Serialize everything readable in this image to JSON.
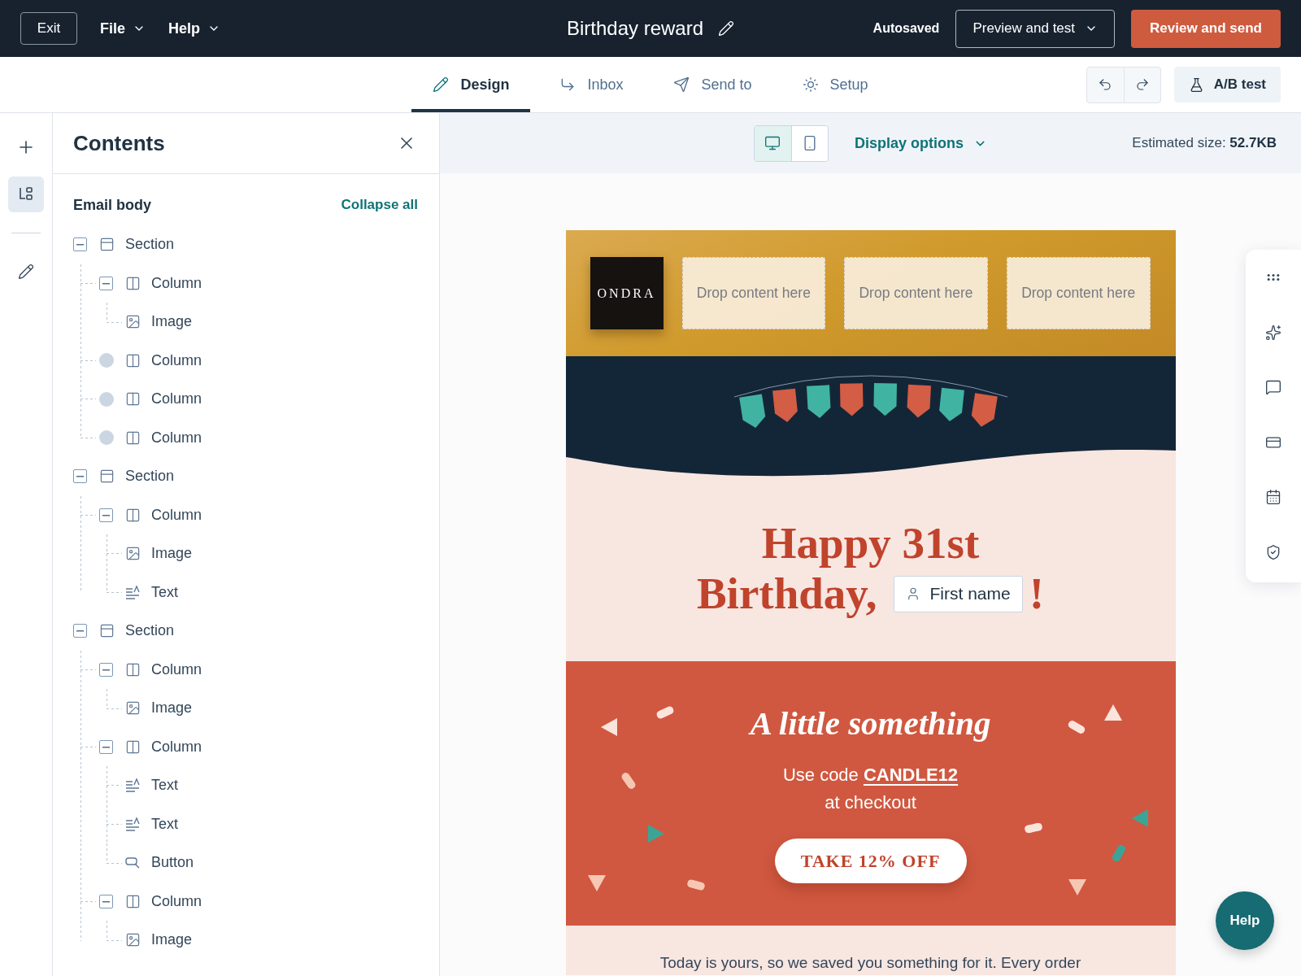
{
  "top_bar": {
    "exit_button": "Exit",
    "menus": [
      "File",
      "Help"
    ],
    "title": "Birthday reward",
    "save_status": "Autosaved",
    "preview_button": "Preview and test",
    "send_button": "Review and send"
  },
  "tabs": [
    {
      "label": "Design",
      "selected": true
    },
    {
      "label": "Inbox",
      "selected": false
    },
    {
      "label": "Send to",
      "selected": false
    },
    {
      "label": "Setup",
      "selected": false
    }
  ],
  "ab_test_button": "A/B test",
  "left_rail": [
    {
      "selected": false
    },
    {
      "selected": true
    },
    {
      "selected": false
    }
  ],
  "contents_panel": {
    "title": "Contents",
    "heading": "Email body",
    "collapse_all": "Collapse all",
    "tree": [
      {
        "kind": "section",
        "label": "Section",
        "expanded": true,
        "children": [
          {
            "kind": "column",
            "label": "Column",
            "expanded": true,
            "children": [
              {
                "kind": "image",
                "label": "Image"
              }
            ]
          },
          {
            "kind": "column",
            "label": "Column"
          },
          {
            "kind": "column",
            "label": "Column"
          },
          {
            "kind": "column",
            "label": "Column"
          }
        ]
      },
      {
        "kind": "section",
        "label": "Section",
        "expanded": true,
        "children": [
          {
            "kind": "column",
            "label": "Column",
            "expanded": true,
            "children": [
              {
                "kind": "image",
                "label": "Image"
              },
              {
                "kind": "text",
                "label": "Text"
              }
            ]
          }
        ]
      },
      {
        "kind": "section",
        "label": "Section",
        "expanded": true,
        "children": [
          {
            "kind": "column",
            "label": "Column",
            "expanded": true,
            "children": [
              {
                "kind": "image",
                "label": "Image"
              }
            ]
          },
          {
            "kind": "column",
            "label": "Column",
            "expanded": true,
            "children": [
              {
                "kind": "text",
                "label": "Text"
              },
              {
                "kind": "text",
                "label": "Text"
              },
              {
                "kind": "button",
                "label": "Button"
              }
            ]
          },
          {
            "kind": "column",
            "label": "Column",
            "expanded": true,
            "children": [
              {
                "kind": "image",
                "label": "Image"
              }
            ]
          }
        ]
      }
    ]
  },
  "canvas_toolbar": {
    "devices": [
      {
        "selected": true
      },
      {
        "selected": false
      }
    ],
    "display_options": "Display options",
    "estimated_size": "Estimated size: **52.7KB**"
  },
  "email": {
    "logo": "ONDRA",
    "drop_zones": [
      "Drop content here",
      "Drop content here",
      "Drop content here"
    ],
    "greeting": {
      "line_1": "Happy 31st",
      "line_2": "Birthday,",
      "token": "First name",
      "end": "!"
    },
    "promo": {
      "title": "A little something",
      "text": "Use code **CANDLE12** at checkout",
      "button": "TAKE 12% OFF"
    },
    "body_text": "Today is yours, so we saved you something for it. Every order"
  },
  "help_button": "Help"
}
